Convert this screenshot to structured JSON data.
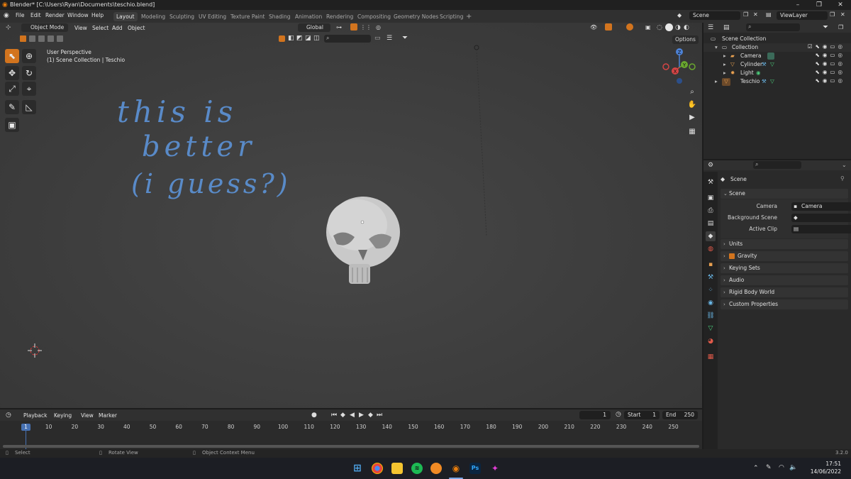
{
  "window": {
    "title": "Blender* [C:\\Users\\Ryan\\Documents\\teschio.blend]",
    "minimize": "–",
    "maximize": "❐",
    "close": "✕"
  },
  "menu": {
    "items": [
      "File",
      "Edit",
      "Render",
      "Window",
      "Help"
    ]
  },
  "workspaces": {
    "tabs": [
      "Layout",
      "Modeling",
      "Sculpting",
      "UV Editing",
      "Texture Paint",
      "Shading",
      "Animation",
      "Rendering",
      "Compositing",
      "Geometry Nodes",
      "Scripting"
    ],
    "active": "Layout",
    "add": "+"
  },
  "scene_selector": {
    "value": "Scene"
  },
  "view_layer_selector": {
    "value": "ViewLayer"
  },
  "viewport": {
    "mode": "Object Mode",
    "menus": [
      "View",
      "Select",
      "Add",
      "Object"
    ],
    "orientation": "Global",
    "options": "Options",
    "overlay_line1": "User Perspective",
    "overlay_line2": "(1) Scene Collection | Teschio",
    "annotation_lines": [
      "this is",
      "better",
      "(i guess?)"
    ],
    "gizmo_axes": {
      "x": "X",
      "y": "Y",
      "z": "Z"
    }
  },
  "timeline": {
    "menus": [
      "Playback",
      "Keying",
      "View",
      "Marker"
    ],
    "current_frame": "1",
    "start_label": "Start",
    "start_value": "1",
    "end_label": "End",
    "end_value": "250",
    "ruler_current": "1",
    "ruler_ticks": [
      "10",
      "20",
      "30",
      "40",
      "50",
      "60",
      "70",
      "80",
      "90",
      "100",
      "110",
      "120",
      "130",
      "140",
      "150",
      "160",
      "170",
      "180",
      "190",
      "200",
      "210",
      "220",
      "230",
      "240",
      "250"
    ]
  },
  "statusbar": {
    "select": "Select",
    "rotate": "Rotate View",
    "context": "Object Context Menu",
    "version": "3.2.0"
  },
  "outliner": {
    "root": "Scene Collection",
    "collection": "Collection",
    "items": [
      {
        "name": "Camera",
        "icon": "camera-icon"
      },
      {
        "name": "Cylinder",
        "icon": "mesh-icon"
      },
      {
        "name": "Light",
        "icon": "light-icon"
      },
      {
        "name": "Teschio",
        "icon": "mesh-icon"
      }
    ]
  },
  "properties": {
    "context": "Scene",
    "scene_panel": "Scene",
    "camera_label": "Camera",
    "camera_value": "Camera",
    "background_scene_label": "Background Scene",
    "active_clip_label": "Active Clip",
    "panels": [
      "Units",
      "Gravity",
      "Keying Sets",
      "Audio",
      "Rigid Body World",
      "Custom Properties"
    ]
  },
  "taskbar": {
    "time": "17:51",
    "date": "14/06/2022",
    "apps": [
      "Windows",
      "Chrome",
      "File Explorer",
      "Spotify",
      "FL Studio",
      "Blender",
      "Photoshop",
      "Other app"
    ],
    "ps_label": "Ps"
  },
  "colors": {
    "accent": "#d2741e",
    "annotation": "#5b8fd0",
    "timeline_current": "#4772b3"
  }
}
